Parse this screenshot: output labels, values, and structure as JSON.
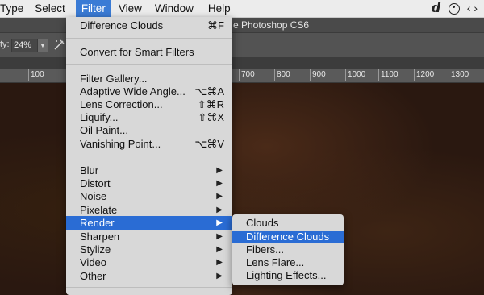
{
  "menubar": {
    "items": [
      "Type",
      "Select",
      "Filter",
      "View",
      "Window",
      "Help"
    ],
    "active": "Filter",
    "right_icons": [
      "d-logo-icon",
      "accessibility-icon",
      "code-brackets-icon"
    ],
    "right_glyphs": {
      "logo": "d",
      "brackets": "‹ ›"
    }
  },
  "ps_title": "e Photoshop CS6",
  "options": {
    "opacity_label": "ty:",
    "opacity_value": "24%",
    "dropdown_glyph": "▼"
  },
  "ruler": {
    "labels": [
      "100",
      "700",
      "800",
      "900",
      "1000",
      "1100",
      "1200",
      "1300"
    ]
  },
  "filter_menu": {
    "last_filter": {
      "label": "Difference Clouds",
      "shortcut": "⌘F"
    },
    "convert": "Convert for Smart Filters",
    "group1": [
      {
        "label": "Filter Gallery...",
        "shortcut": ""
      },
      {
        "label": "Adaptive Wide Angle...",
        "shortcut": "⌥⌘A"
      },
      {
        "label": "Lens Correction...",
        "shortcut": "⇧⌘R"
      },
      {
        "label": "Liquify...",
        "shortcut": "⇧⌘X"
      },
      {
        "label": "Oil Paint...",
        "shortcut": ""
      },
      {
        "label": "Vanishing Point...",
        "shortcut": "⌥⌘V"
      }
    ],
    "submenus": [
      "Blur",
      "Distort",
      "Noise",
      "Pixelate",
      "Render",
      "Sharpen",
      "Stylize",
      "Video",
      "Other"
    ],
    "highlighted": "Render",
    "arrow_glyph": "▶"
  },
  "render_submenu": {
    "items": [
      "Clouds",
      "Difference Clouds",
      "Fibers...",
      "Lens Flare...",
      "Lighting Effects..."
    ],
    "highlighted": "Difference Clouds"
  },
  "colors": {
    "highlight": "#2a6cd4",
    "menu_bg": "#d8d8d8",
    "canvas": "#2a1810"
  }
}
